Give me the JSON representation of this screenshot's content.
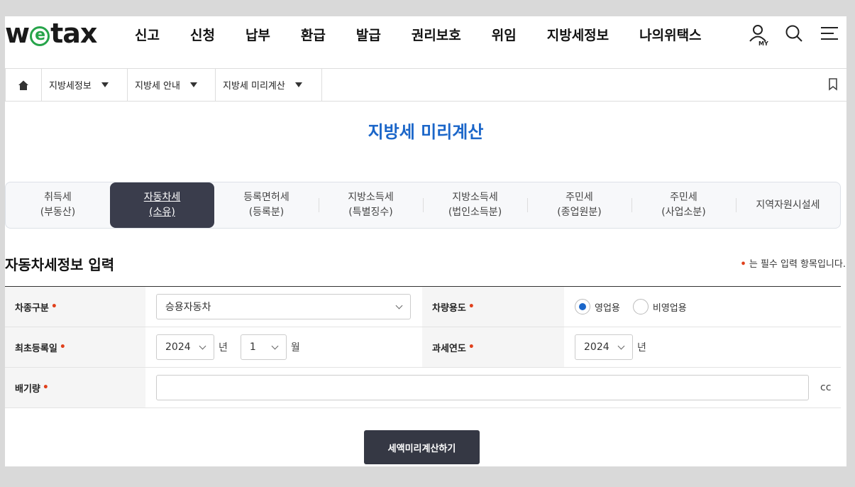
{
  "header": {
    "logo": {
      "pre": "w",
      "mid": "e",
      "post": "tax"
    },
    "nav": [
      "신고",
      "신청",
      "납부",
      "환급",
      "발급",
      "권리보호",
      "위임",
      "지방세정보",
      "나의위택스"
    ],
    "icons": [
      "my-page-icon",
      "search-icon",
      "menu-icon"
    ],
    "my_label": "MY"
  },
  "breadcrumb": {
    "items": [
      "지방세정보",
      "지방세 안내",
      "지방세 미리계산"
    ]
  },
  "page_title": "지방세 미리계산",
  "tabs": [
    {
      "l1": "취득세",
      "l2": "(부동산)"
    },
    {
      "l1": "자동차세",
      "l2": "(소유)"
    },
    {
      "l1": "등록면허세",
      "l2": "(등록분)"
    },
    {
      "l1": "지방소득세",
      "l2": "(특별징수)"
    },
    {
      "l1": "지방소득세",
      "l2": "(법인소득분)"
    },
    {
      "l1": "주민세",
      "l2": "(종업원분)"
    },
    {
      "l1": "주민세",
      "l2": "(사업소분)"
    },
    {
      "l1": "지역자원시설세",
      "l2": ""
    }
  ],
  "section": {
    "title": "자동차세정보 입력",
    "required_note": "는 필수 입력 항목입니다."
  },
  "form": {
    "car_type_label": "차종구분",
    "car_type_value": "승용자동차",
    "usage_label": "차량용도",
    "usage_options": [
      "영업용",
      "비영업용"
    ],
    "first_reg_label": "최초등록일",
    "first_reg_year": "2024",
    "first_reg_year_unit": "년",
    "first_reg_month": "1",
    "first_reg_month_unit": "월",
    "tax_year_label": "과세연도",
    "tax_year_value": "2024",
    "tax_year_unit": "년",
    "displacement_label": "배기량",
    "displacement_unit": "cc"
  },
  "submit_label": "세액미리계산하기",
  "colors": {
    "accent": "#1b66c9",
    "active_tab": "#3a3d4c",
    "required": "#e0401c"
  }
}
